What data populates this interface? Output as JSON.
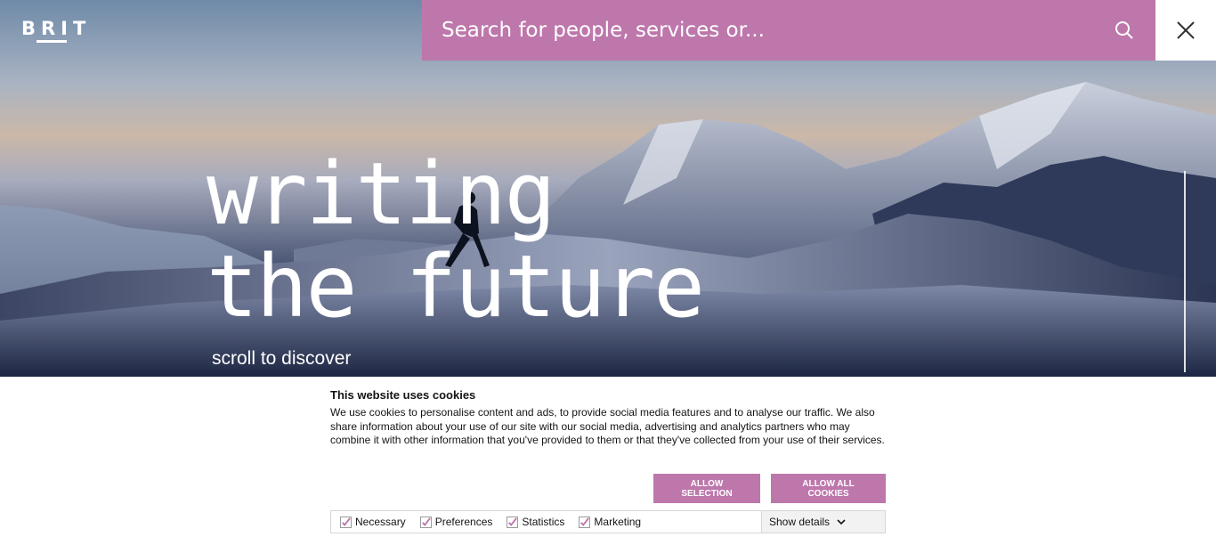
{
  "header": {
    "logo_text": "BRIT",
    "search": {
      "placeholder": "Search for people, services or..."
    },
    "search_icon": "search-icon",
    "close_icon": "close-icon",
    "search_bar_color": "#bd77ab"
  },
  "hero": {
    "headline_line1": "writing",
    "headline_line2": "the future",
    "scroll_text": "scroll to discover"
  },
  "cookie_banner": {
    "title": "This website uses cookies",
    "text": "We use cookies to personalise content and ads, to provide social media features and to analyse our traffic. We also share information about your use of our site with our social media, advertising and analytics partners who may combine it with other information that you've provided to them or that they've collected from your use of their services.",
    "allow_selection": "ALLOW SELECTION",
    "allow_all": "ALLOW ALL COOKIES",
    "preferences": [
      {
        "label": "Necessary",
        "checked": true
      },
      {
        "label": "Preferences",
        "checked": true
      },
      {
        "label": "Statistics",
        "checked": true
      },
      {
        "label": "Marketing",
        "checked": true
      }
    ],
    "show_details": "Show details",
    "accent_color": "#bd77ab"
  }
}
